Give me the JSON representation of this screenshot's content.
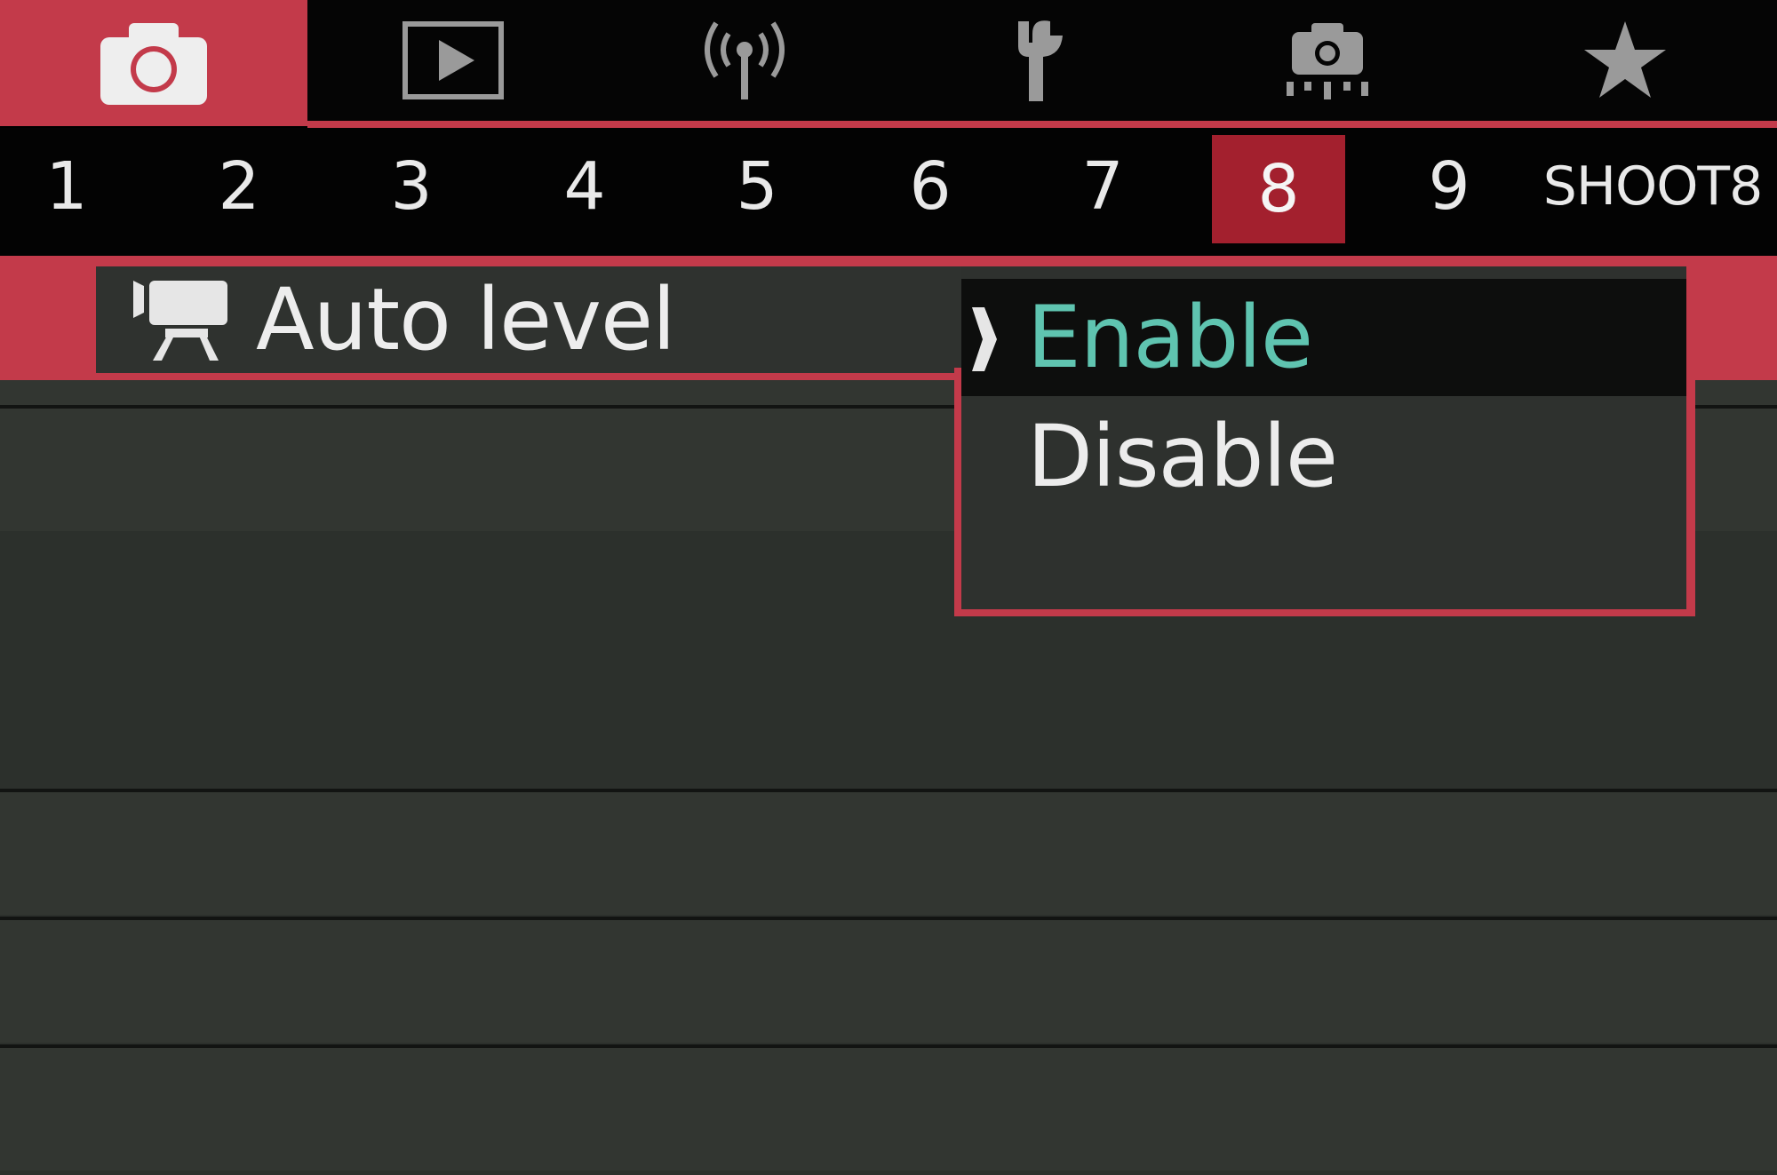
{
  "category_tabs": [
    {
      "icon": "camera-shooting-icon",
      "active": true
    },
    {
      "icon": "playback-icon",
      "active": false
    },
    {
      "icon": "wireless-icon",
      "active": false
    },
    {
      "icon": "wrench-setup-icon",
      "active": false
    },
    {
      "icon": "custom-functions-camera-icon",
      "active": false
    },
    {
      "icon": "my-menu-star-icon",
      "active": false
    }
  ],
  "page_tabs": {
    "numbers": [
      "1",
      "2",
      "3",
      "4",
      "5",
      "6",
      "7",
      "8",
      "9"
    ],
    "active_index": 7,
    "title": "SHOOT8"
  },
  "menu_item": {
    "icon": "movie-tripod-icon",
    "label": "Auto level"
  },
  "options": {
    "enable": "Enable",
    "disable": "Disable",
    "selected": "Enable"
  },
  "colors": {
    "accent_red": "#c33a4a",
    "selected_text": "#5fc4b0",
    "menu_background": "#323631"
  }
}
